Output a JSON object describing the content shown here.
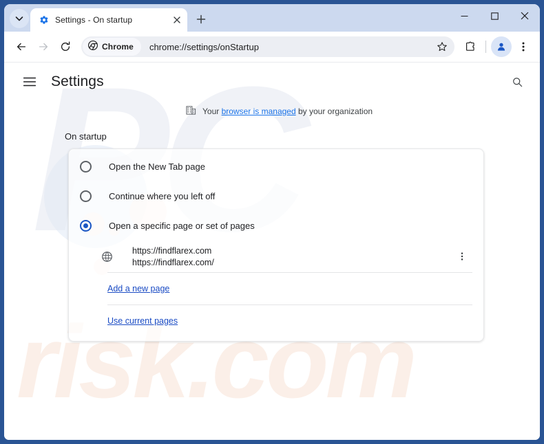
{
  "window": {
    "controls": {
      "minimize": "minimize",
      "maximize": "maximize",
      "close": "close"
    }
  },
  "tabstrip": {
    "tab_search_tooltip": "Search tabs",
    "tabs": [
      {
        "title": "Settings - On startup",
        "favicon": "settings-gear-icon",
        "close": "close-tab-icon"
      }
    ],
    "new_tab_label": "+"
  },
  "toolbar": {
    "back": "back-icon",
    "forward": "forward-icon",
    "reload": "reload-icon",
    "chrome_chip_label": "Chrome",
    "url": "chrome://settings/onStartup",
    "bookmark": "star-icon",
    "extensions": "extensions-icon",
    "profile": "profile-icon",
    "menu": "three-dot-menu-icon"
  },
  "settings": {
    "menu_label": "main-menu",
    "title": "Settings",
    "search_label": "search-settings",
    "managed": {
      "icon": "enterprise-building-icon",
      "prefix": "Your ",
      "link": "browser is managed",
      "suffix": " by your organization"
    },
    "section_title": "On startup",
    "options": [
      {
        "label": "Open the New Tab page",
        "selected": false
      },
      {
        "label": "Continue where you left off",
        "selected": false
      },
      {
        "label": "Open a specific page or set of pages",
        "selected": true
      }
    ],
    "startup_pages": [
      {
        "icon": "globe-icon",
        "title": "https://findflarex.com",
        "url": "https://findflarex.com/",
        "menu": "more-actions-icon"
      }
    ],
    "add_page_link": "Add a new page",
    "use_current_link": "Use current pages"
  },
  "watermark": {
    "top_text": "PC",
    "bottom_text": "risk.com"
  },
  "colors": {
    "frame": "#2a5494",
    "tabstrip": "#ccd9ef",
    "accent": "#1a73e8",
    "radio_selected": "#1a56c4",
    "link": "#1a4bc4"
  }
}
